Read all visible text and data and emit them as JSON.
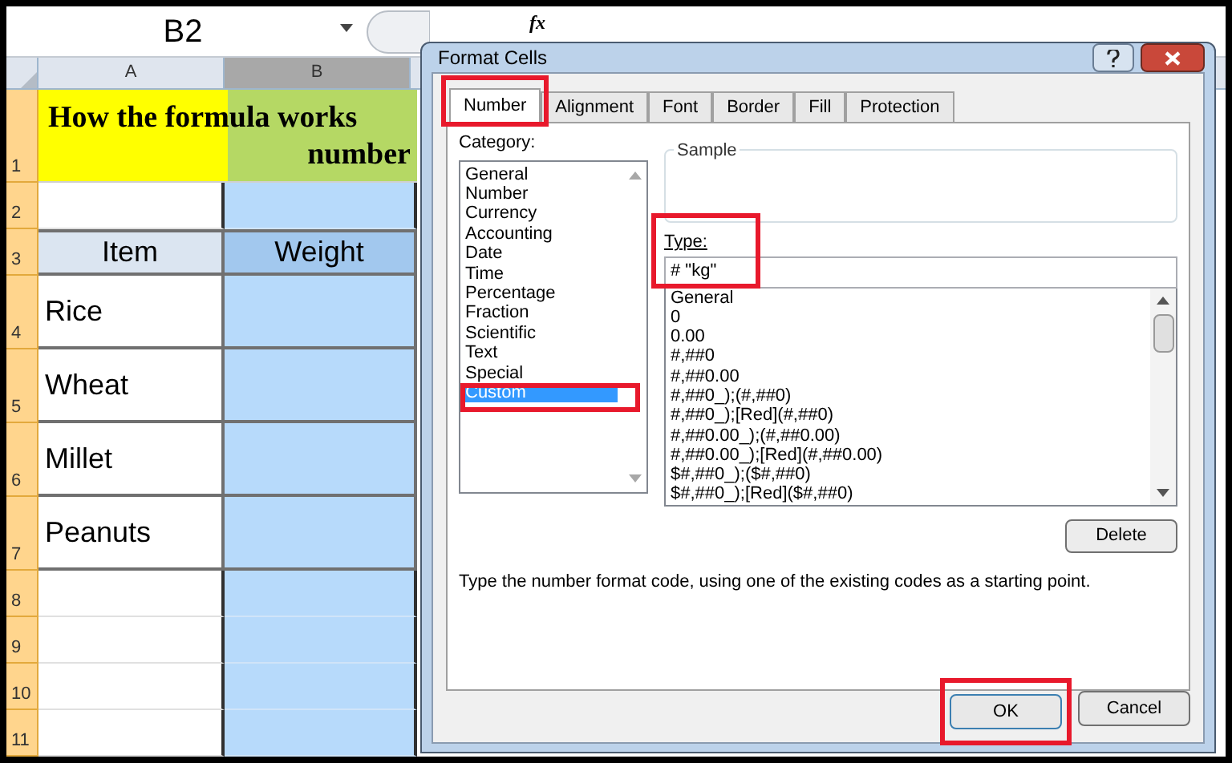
{
  "name_box": "B2",
  "function_label": "fx",
  "columns": [
    {
      "label": "A",
      "selected": false
    },
    {
      "label": "B",
      "selected": true
    }
  ],
  "rows": [
    {
      "number": "1",
      "kind": "title",
      "cells": [
        "How the formula works",
        "number"
      ]
    },
    {
      "number": "2",
      "kind": "blank"
    },
    {
      "number": "3",
      "kind": "header",
      "cells": [
        "Item",
        "Weight"
      ]
    },
    {
      "number": "4",
      "kind": "data",
      "cells": [
        "Rice"
      ]
    },
    {
      "number": "5",
      "kind": "data",
      "cells": [
        "Wheat"
      ]
    },
    {
      "number": "6",
      "kind": "data",
      "cells": [
        "Millet"
      ]
    },
    {
      "number": "7",
      "kind": "data",
      "cells": [
        "Peanuts"
      ]
    },
    {
      "number": "8",
      "kind": "blank"
    },
    {
      "number": "9",
      "kind": "blank"
    },
    {
      "number": "10",
      "kind": "blank"
    },
    {
      "number": "11",
      "kind": "blank"
    }
  ],
  "dialog": {
    "title": "Format Cells",
    "tabs": [
      {
        "label": "Number",
        "selected": true,
        "highlighted": true
      },
      {
        "label": "Alignment",
        "selected": false,
        "highlighted": false
      },
      {
        "label": "Font",
        "selected": false,
        "highlighted": false
      },
      {
        "label": "Border",
        "selected": false,
        "highlighted": false
      },
      {
        "label": "Fill",
        "selected": false,
        "highlighted": false
      },
      {
        "label": "Protection",
        "selected": false,
        "highlighted": false
      }
    ],
    "category_label": "Category:",
    "categories": [
      {
        "label": "General",
        "selected": false,
        "highlighted": false
      },
      {
        "label": "Number",
        "selected": false,
        "highlighted": false
      },
      {
        "label": "Currency",
        "selected": false,
        "highlighted": false
      },
      {
        "label": "Accounting",
        "selected": false,
        "highlighted": false
      },
      {
        "label": "Date",
        "selected": false,
        "highlighted": false
      },
      {
        "label": "Time",
        "selected": false,
        "highlighted": false
      },
      {
        "label": "Percentage",
        "selected": false,
        "highlighted": false
      },
      {
        "label": "Fraction",
        "selected": false,
        "highlighted": false
      },
      {
        "label": "Scientific",
        "selected": false,
        "highlighted": false
      },
      {
        "label": "Text",
        "selected": false,
        "highlighted": false
      },
      {
        "label": "Special",
        "selected": false,
        "highlighted": false
      },
      {
        "label": "Custom",
        "selected": true,
        "highlighted": true
      }
    ],
    "sample_label": "Sample",
    "type_label": "Type:",
    "type_value": "# \"kg\"",
    "type_highlighted": true,
    "formats": [
      "General",
      "0",
      "0.00",
      "#,##0",
      "#,##0.00",
      "#,##0_);(#,##0)",
      "#,##0_);[Red](#,##0)",
      "#,##0.00_);(#,##0.00)",
      "#,##0.00_);[Red](#,##0.00)",
      "$#,##0_);($#,##0)",
      "$#,##0_);[Red]($#,##0)"
    ],
    "delete_button": "Delete",
    "description": "Type the number format code, using one of the existing codes as a starting point.",
    "buttons": [
      {
        "label": "OK",
        "highlighted": true
      },
      {
        "label": "Cancel",
        "highlighted": false
      }
    ]
  }
}
